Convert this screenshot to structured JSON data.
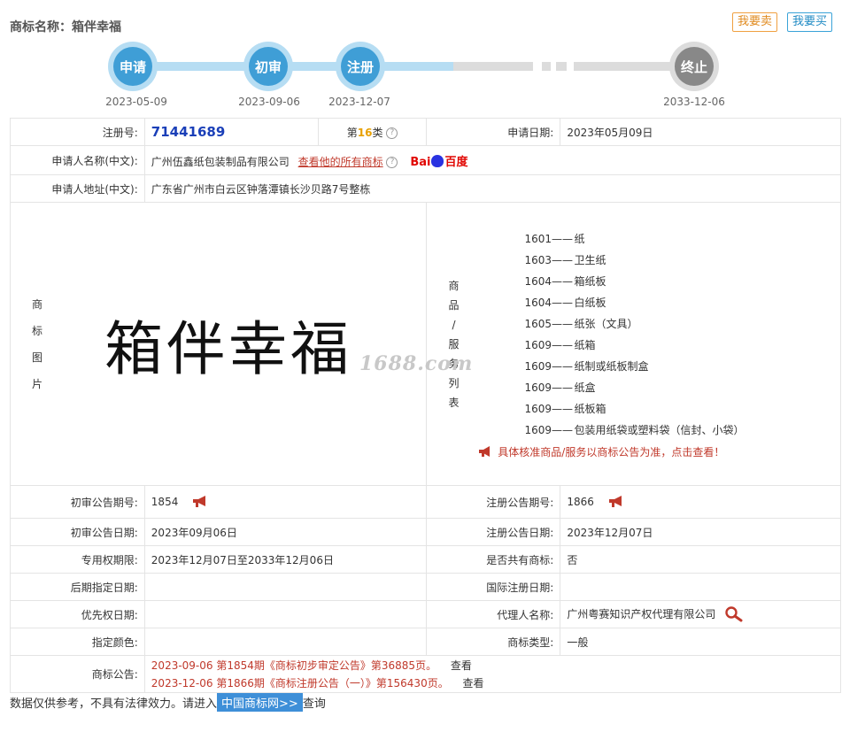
{
  "header": {
    "title": "商标名称：箱伴幸福",
    "sell_label": "我要卖",
    "buy_label": "我要买"
  },
  "timeline": [
    {
      "label": "申请",
      "date": "2023-05-09",
      "state": "done"
    },
    {
      "label": "初审",
      "date": "2023-09-06",
      "state": "done"
    },
    {
      "label": "注册",
      "date": "2023-12-07",
      "state": "done"
    },
    {
      "label": "终止",
      "date": "2033-12-06",
      "state": "future"
    }
  ],
  "info": {
    "reg_no_label": "注册号:",
    "reg_no": "71441689",
    "class_prefix": "第",
    "class_no": "16",
    "class_suffix": "类",
    "apply_date_label": "申请日期:",
    "apply_date": "2023年05月09日",
    "applicant_label": "申请人名称(中文):",
    "applicant": "广州伍鑫纸包装制品有限公司",
    "applicant_link": "查看他的所有商标",
    "baidu_bai": "Bai",
    "baidu_du": "百度",
    "address_label": "申请人地址(中文):",
    "address": "广东省广州市白云区钟落潭镇长沙贝路7号整栋",
    "image_label_chars": [
      "商",
      "标",
      "图",
      "片"
    ],
    "logo_text": "箱伴幸福",
    "goods_label_chars": [
      "商",
      "品",
      "/",
      "服",
      "务",
      "列",
      "表"
    ],
    "goods": [
      {
        "code": "1601——",
        "name": "纸"
      },
      {
        "code": "1603——",
        "name": "卫生纸"
      },
      {
        "code": "1604——",
        "name": "箱纸板"
      },
      {
        "code": "1604——",
        "name": "白纸板"
      },
      {
        "code": "1605——",
        "name": "纸张（文具）"
      },
      {
        "code": "1609——",
        "name": "纸箱"
      },
      {
        "code": "1609——",
        "name": "纸制或纸板制盒"
      },
      {
        "code": "1609——",
        "name": "纸盒"
      },
      {
        "code": "1609——",
        "name": "纸板箱"
      },
      {
        "code": "1609——",
        "name": "包装用纸袋或塑料袋（信封、小袋）"
      }
    ],
    "goods_notice": "具体核准商品/服务以商标公告为准，点击查看！",
    "watermark": "1688.com",
    "prelim_no_label": "初审公告期号:",
    "prelim_no": "1854",
    "reg_pub_no_label": "注册公告期号:",
    "reg_pub_no": "1866",
    "prelim_date_label": "初审公告日期:",
    "prelim_date": "2023年09月06日",
    "reg_pub_date_label": "注册公告日期:",
    "reg_pub_date": "2023年12月07日",
    "exclusive_label": "专用权期限:",
    "exclusive": "2023年12月07日至2033年12月06日",
    "shared_label": "是否共有商标:",
    "shared": "否",
    "later_label": "后期指定日期:",
    "later": "",
    "intl_label": "国际注册日期:",
    "intl": "",
    "priority_label": "优先权日期:",
    "priority": "",
    "agent_label": "代理人名称:",
    "agent": "广州粤赛知识产权代理有限公司",
    "color_label": "指定颜色:",
    "color": "",
    "type_label": "商标类型:",
    "type": "一般",
    "announce_label": "商标公告:",
    "announcements": [
      {
        "text": "2023-09-06 第1854期《商标初步审定公告》第36885页。",
        "action": "查看"
      },
      {
        "text": "2023-12-06 第1866期《商标注册公告（一）》第156430页。",
        "action": "查看"
      }
    ]
  },
  "footer": {
    "pre": "数据仅供参考，不具有法律效力。请进入",
    "link": "中国商标网>>",
    "post": "查询"
  },
  "colors": {
    "accent_blue": "#3f9ed6",
    "red": "#c0392b",
    "orange": "#e8a000"
  }
}
